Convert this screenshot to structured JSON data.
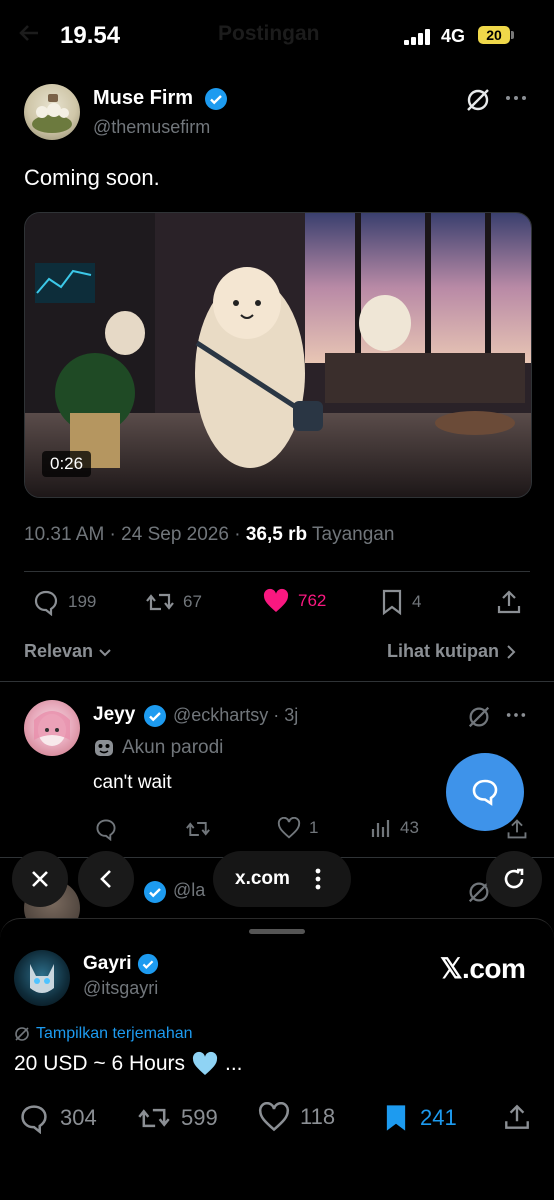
{
  "status_bar": {
    "time": "19.54",
    "network": "4G",
    "battery": "20"
  },
  "header": {
    "title": "Postingan"
  },
  "post": {
    "author_name": "Muse Firm",
    "author_handle": "@themusefirm",
    "text": "Coming soon.",
    "video_duration": "0:26",
    "timestamp": "10.31 AM · 24 Sep 2026 · ",
    "views_count": "36,5 rb",
    "views_label": "Tayangan",
    "replies": "199",
    "reposts": "67",
    "likes": "762",
    "bookmarks": "4"
  },
  "sort": {
    "left": "Relevan",
    "right": "Lihat kutipan"
  },
  "reply": {
    "author_name": "Jeyy",
    "author_handle": "@eckhartsy · 3j",
    "parody_label": "Akun parodi",
    "text": "can't wait",
    "likes": "1",
    "views": "43"
  },
  "hidden_reply": {
    "name_fragment": "u",
    "handle_fragment": "@la"
  },
  "browser": {
    "url": "x.com"
  },
  "sheet": {
    "author_name": "Gayri",
    "author_handle": "@itsgayri",
    "logo_text": "𝕏.com",
    "translate_label": "Tampilkan terjemahan",
    "text": "20 USD ~ 6 Hours",
    "text_suffix": "...",
    "replies": "304",
    "reposts": "599",
    "likes": "118",
    "bookmarks": "241"
  },
  "colors": {
    "like": "#f91880",
    "accent": "#1d9bf0",
    "fab": "#3e93ea"
  }
}
